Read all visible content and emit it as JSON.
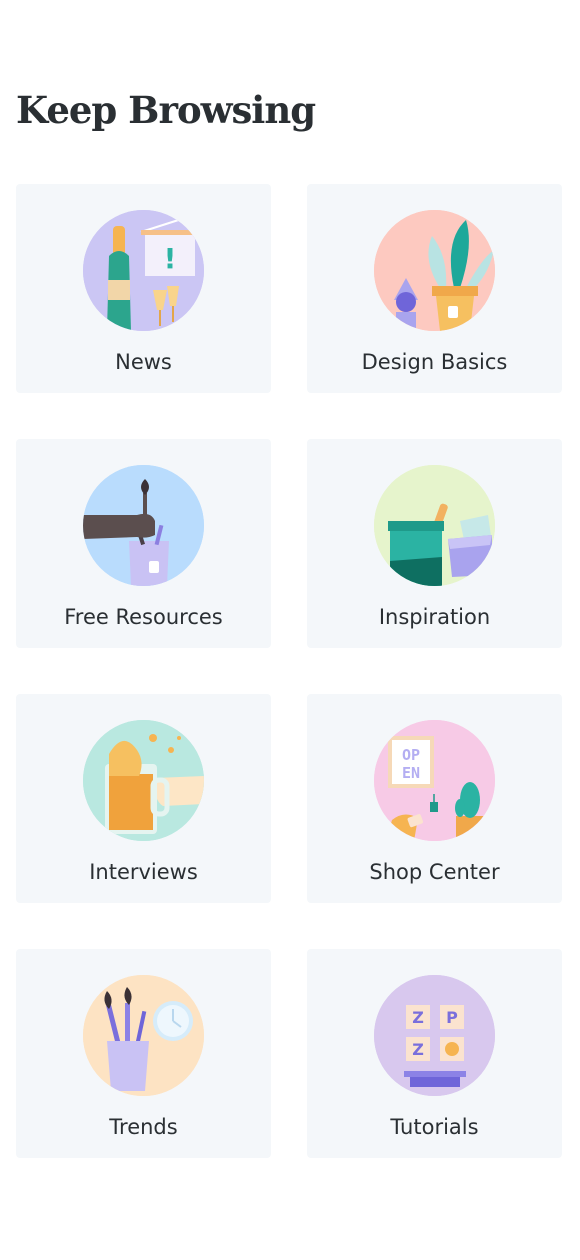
{
  "heading": "Keep Browsing",
  "cards": [
    {
      "label": "News",
      "icon": "champagne-announcement-icon",
      "bg": "#cbc6f4"
    },
    {
      "label": "Design Basics",
      "icon": "plant-pot-shapes-icon",
      "bg": "#fdc9c0"
    },
    {
      "label": "Free Resources",
      "icon": "hand-paintbrush-icon",
      "bg": "#b9dcfd"
    },
    {
      "label": "Inspiration",
      "icon": "paint-bucket-icon",
      "bg": "#e6f4cc"
    },
    {
      "label": "Interviews",
      "icon": "beer-mug-toast-icon",
      "bg": "#b9e8e0"
    },
    {
      "label": "Shop Center",
      "icon": "open-sign-cactus-icon",
      "bg": "#f7cae6"
    },
    {
      "label": "Trends",
      "icon": "brushes-clock-icon",
      "bg": "#fde3c3"
    },
    {
      "label": "Tutorials",
      "icon": "letter-blocks-icon",
      "bg": "#d8c8ee"
    }
  ],
  "illustration_text": {
    "open_sign_line1": "OP",
    "open_sign_line2": "EN",
    "block_z1": "Z",
    "block_p": "P",
    "block_z2": "Z",
    "news_exclaim": "!"
  }
}
